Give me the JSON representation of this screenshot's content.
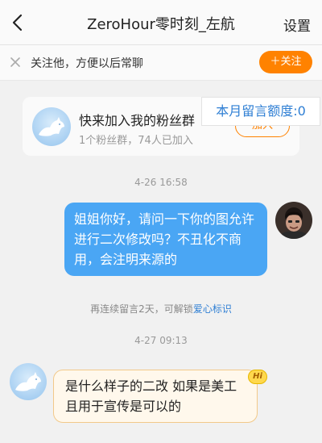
{
  "header": {
    "title": "ZeroHour零时刻_左航",
    "settings_label": "设置"
  },
  "follow_bar": {
    "text": "关注他，方便以后常聊",
    "button_label": "＋关注"
  },
  "fan_group": {
    "title": "快来加入我的粉丝群",
    "subtitle": "1个粉丝群，74人已加入",
    "join_label": "加入"
  },
  "quota": "本月留言额度:0",
  "messages": [
    {
      "time": "4-26 16:58",
      "text": "姐姐你好，请问一下你的图允许进行二次修改吗？不丑化不商用，会注明来源的"
    },
    {
      "time": "4-27 09:13",
      "text": "是什么样子的二改 如果是美工且用于宣传是可以的"
    }
  ],
  "unlock_note": {
    "prefix": "再连续留言2天，可解锁",
    "link": "爱心标识"
  },
  "badge": "Hi",
  "colors": {
    "accent_orange": "#ff8200",
    "my_bubble": "#4aa6f4",
    "link_blue": "#2f7fd4"
  }
}
